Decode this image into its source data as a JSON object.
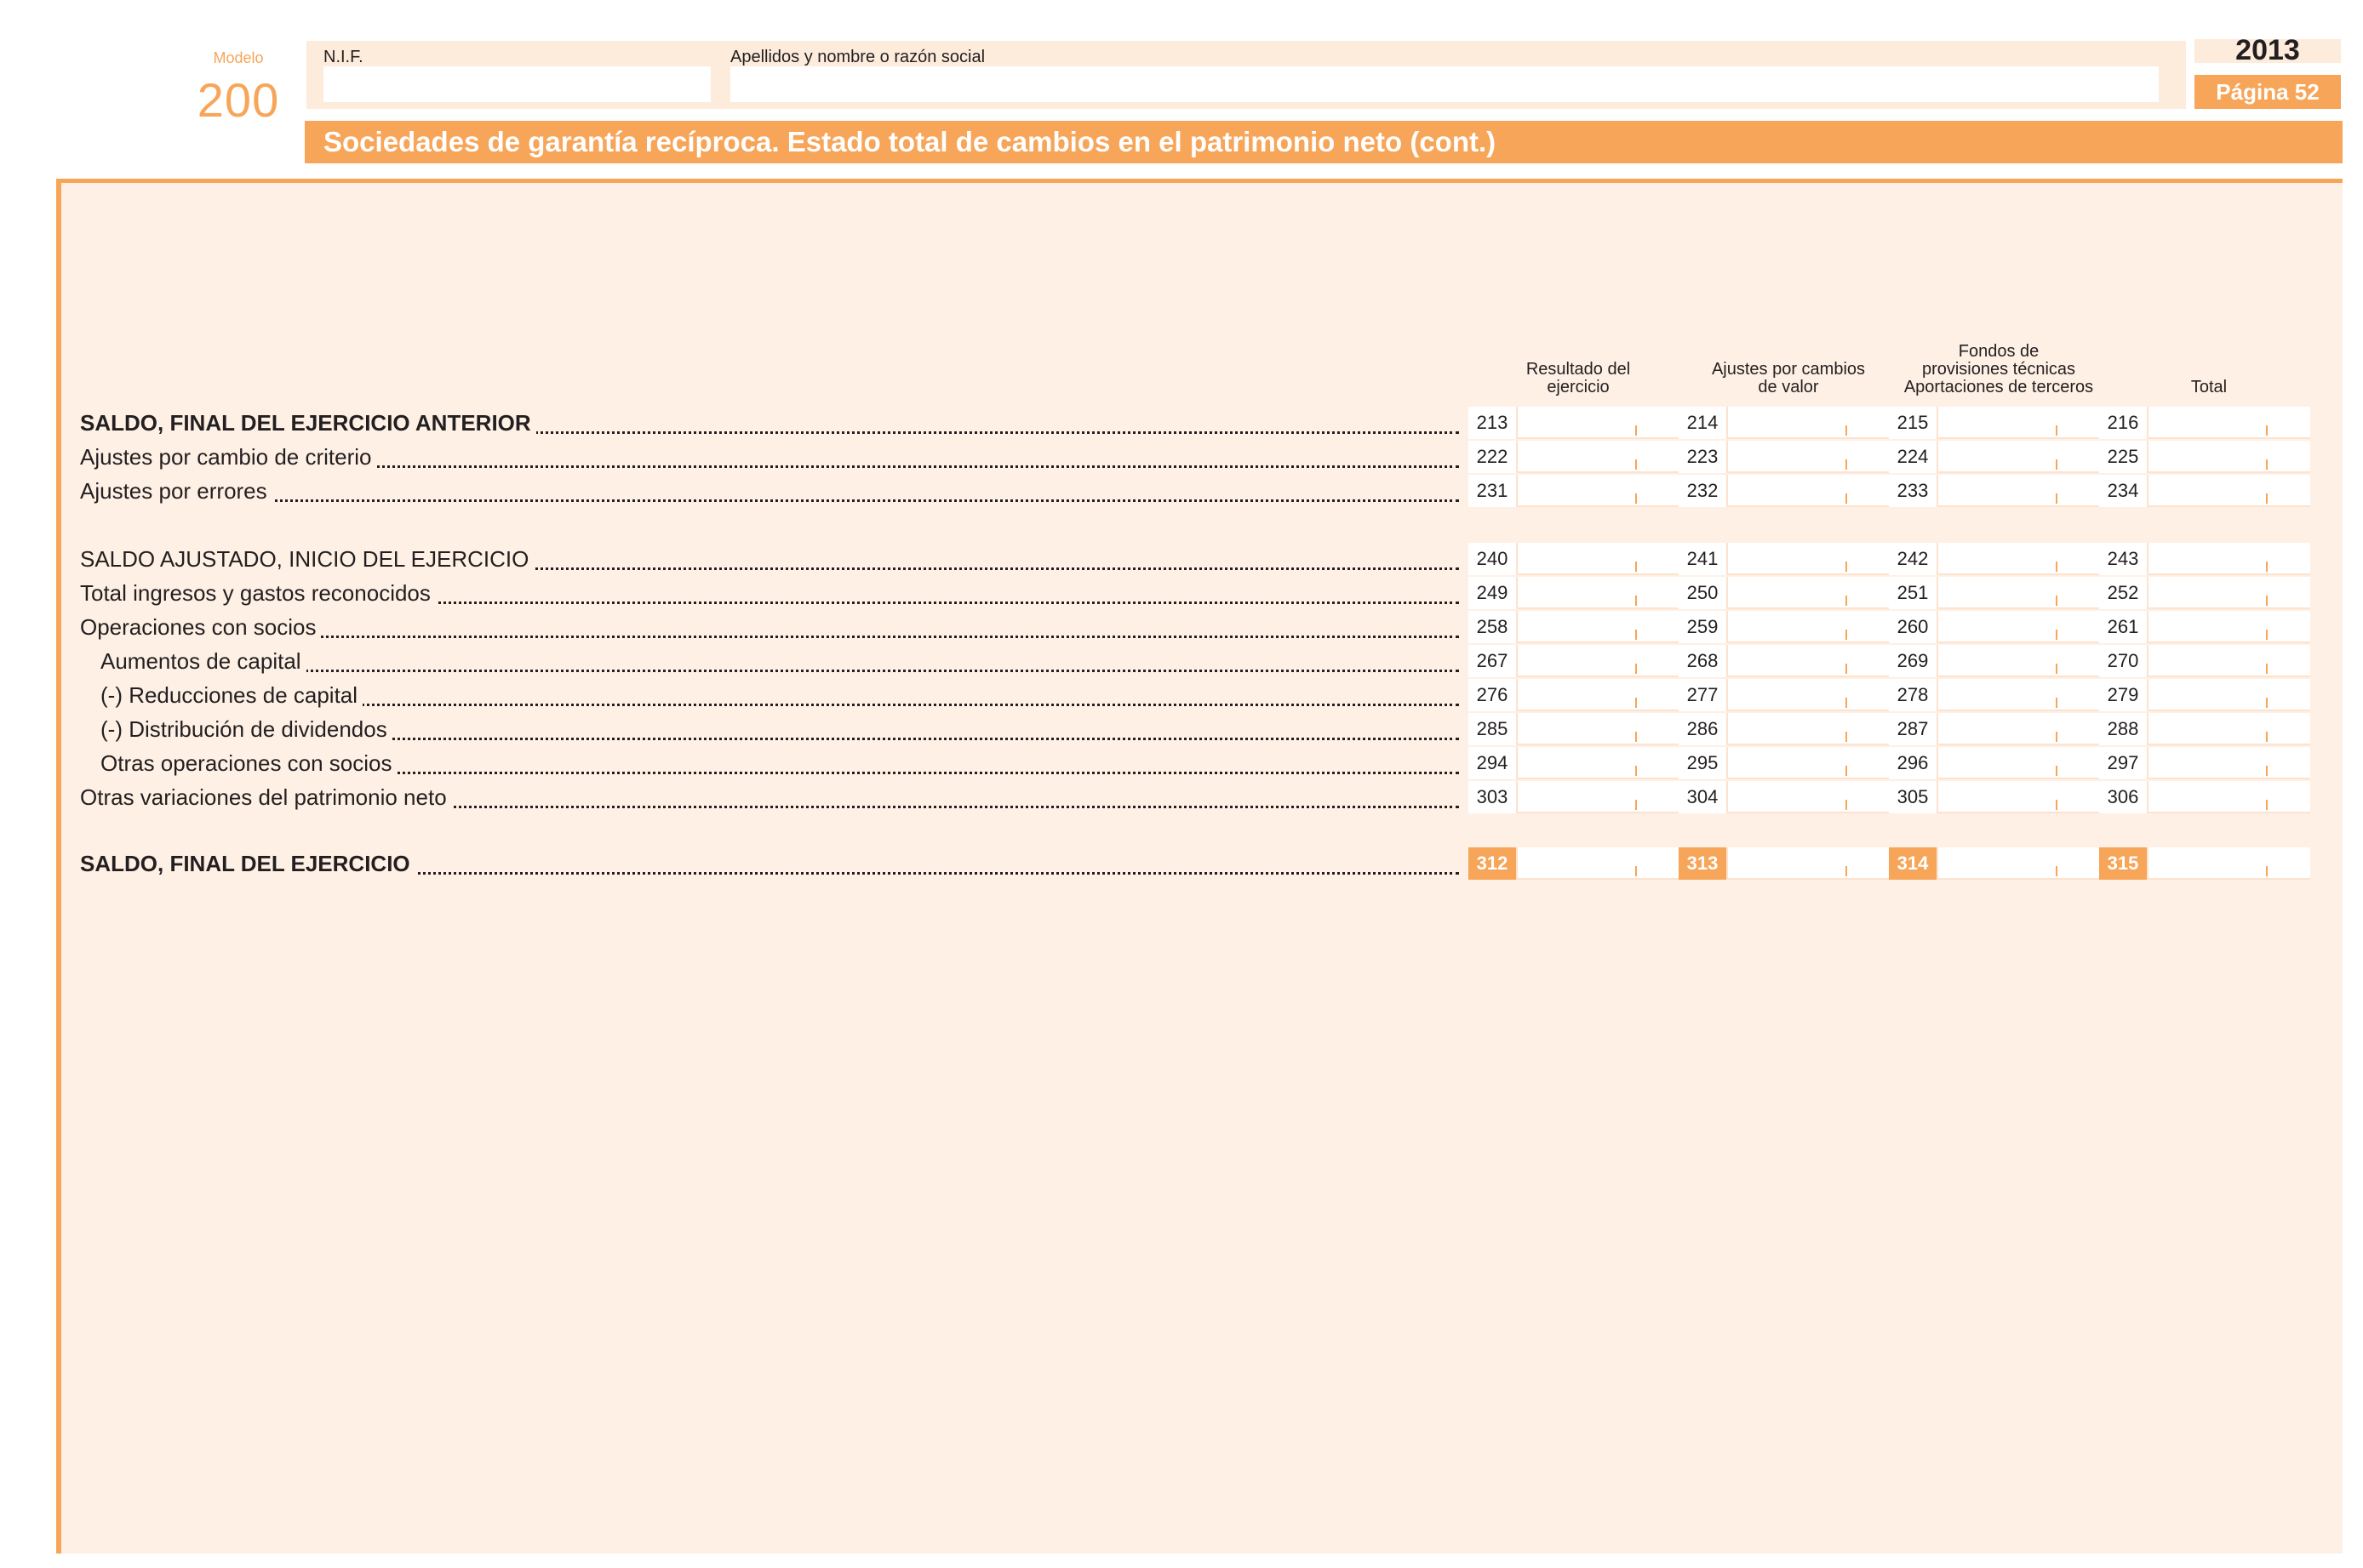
{
  "header": {
    "modelo_label": "Modelo",
    "modelo_number": "200",
    "nif_label": "N.I.F.",
    "nif_value": "",
    "name_label": "Apellidos y nombre o razón social",
    "name_value": "",
    "year": "2013",
    "page_label": "Página 52"
  },
  "title": "Sociedades de garantía recíproca. Estado total de cambios en el patrimonio neto (cont.)",
  "columns": [
    {
      "label": "Resultado del\nejercicio"
    },
    {
      "label": "Ajustes por cambios\nde valor"
    },
    {
      "label": "Fondos de\nprovisiones técnicas\nAportaciones de terceros"
    },
    {
      "label": "Total"
    }
  ],
  "rows": [
    {
      "label": "SALDO, FINAL DEL EJERCICIO ANTERIOR",
      "bold": true,
      "codes": [
        "213",
        "214",
        "215",
        "216"
      ]
    },
    {
      "label": "Ajustes por cambio de criterio",
      "codes": [
        "222",
        "223",
        "224",
        "225"
      ]
    },
    {
      "label": "Ajustes por errores",
      "codes": [
        "231",
        "232",
        "233",
        "234"
      ]
    },
    {
      "label": "SALDO AJUSTADO, INICIO DEL EJERCICIO",
      "codes": [
        "240",
        "241",
        "242",
        "243"
      ]
    },
    {
      "label": "Total ingresos y gastos reconocidos",
      "codes": [
        "249",
        "250",
        "251",
        "252"
      ]
    },
    {
      "label": "Operaciones con socios",
      "codes": [
        "258",
        "259",
        "260",
        "261"
      ]
    },
    {
      "label": "Aumentos de capital",
      "indent": true,
      "codes": [
        "267",
        "268",
        "269",
        "270"
      ]
    },
    {
      "label": "(-) Reducciones de capital",
      "indent": true,
      "codes": [
        "276",
        "277",
        "278",
        "279"
      ]
    },
    {
      "label": "(-) Distribución de dividendos",
      "indent": true,
      "codes": [
        "285",
        "286",
        "287",
        "288"
      ]
    },
    {
      "label": "Otras operaciones con socios",
      "indent": true,
      "codes": [
        "294",
        "295",
        "296",
        "297"
      ]
    },
    {
      "label": "Otras variaciones del patrimonio neto",
      "codes": [
        "303",
        "304",
        "305",
        "306"
      ]
    },
    {
      "label": "SALDO, FINAL DEL EJERCICIO",
      "bold": true,
      "highlight": true,
      "codes": [
        "312",
        "313",
        "314",
        "315"
      ]
    }
  ]
}
